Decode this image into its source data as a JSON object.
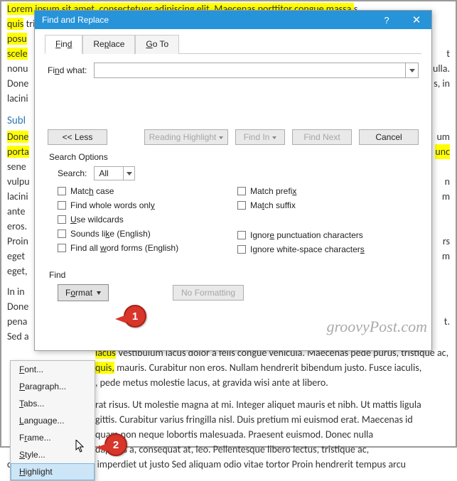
{
  "dialog": {
    "title": "Find and Replace",
    "tabs": {
      "find": "Find",
      "replace": "Replace",
      "goto": "Go To"
    },
    "find_what_label": "Find what:",
    "buttons": {
      "less": "<< Less",
      "reading_highlight": "Reading Highlight",
      "find_in": "Find In",
      "find_next": "Find Next",
      "cancel": "Cancel",
      "format": "Format",
      "no_formatting": "No Formatting"
    },
    "search_options_label": "Search Options",
    "search_label": "Search:",
    "search_value": "All",
    "checks": {
      "match_case": "Match case",
      "whole_words": "Find whole words only",
      "wildcards": "Use wildcards",
      "sounds_like": "Sounds like (English)",
      "word_forms": "Find all word forms (English)",
      "match_prefix": "Match prefix",
      "match_suffix": "Match suffix",
      "ignore_punct": "Ignore punctuation characters",
      "ignore_ws": "Ignore white-space characters"
    },
    "find_label": "Find"
  },
  "format_menu": {
    "font": "Font...",
    "paragraph": "Paragraph...",
    "tabs": "Tabs...",
    "language": "Language...",
    "frame": "Frame...",
    "style": "Style...",
    "highlight": "Highlight"
  },
  "markers": {
    "m1": "1",
    "m2": "2"
  },
  "watermark": "groovyPost.com",
  "doc": {
    "p1a": "Lorem ipsum sit amet, consectetuer adipiscing elit. Maecenas porttitor congue massa.",
    "p1b": "s",
    "p2a": "quis",
    "p2b": " tristic",
    "p3": "posu",
    "p4a": "scele",
    "p4b": "t",
    "p5a": "nonu",
    "p5b": "ulla.",
    "p6a": "Done",
    "p6b": "s, in",
    "p7": "lacini",
    "h1": "Subl",
    "p8a": "Done",
    "p8b": "um",
    "p9a": "porta",
    "p9b": "unc",
    "p10": "sene",
    "p11a": "vulpu",
    "p11b": "n",
    "p12a": "lacini",
    "p12b": "m",
    "p13": "ante",
    "p14": "eros.",
    "p15a": "Proin",
    "p15b": "rs",
    "p16a": "eget",
    "p16b": "m",
    "p17": "eget,",
    "p18": "In in",
    "p19": "Done",
    "p20a": "pena",
    "p20b": "t.",
    "p21": "Sed a",
    "p22a": "lacus",
    "p22b": "Vestibulum lacus dolor a felis congue vehicula. Maecenas pede purus, tristique ac,",
    "p23a": "quis,",
    "p23b": " mauris. Curabitur non eros. Nullam hendrerit bibendum justo. Fusce iaculis,",
    "p24": ", pede metus molestie lacus, at gravida wisi ante at libero.",
    "p25a": "rat risus. Ut molestie magna at mi. Integer aliquet mauris et nibh. Ut mattis ligula",
    "p25b": "gittis. Curabitur varius fringilla nisl. Duis pretium mi euismod erat. Maecenas id",
    "p25c": "quam non neque lobortis malesuada. Praesent euismod. Donec nulla",
    "p25d": "dapibus a, consequat at, leo. Pellentesque libero lectus, tristique ac,",
    "p26": "consectetuer sit amet imperdiet ut justo Sed aliquam odio vitae tortor Proin hendrerit tempus arcu"
  }
}
